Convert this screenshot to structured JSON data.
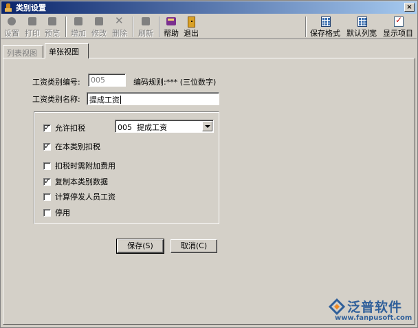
{
  "window": {
    "title": "类别设置",
    "close_label": "×"
  },
  "toolbar": {
    "left_buttons": [
      {
        "label": "设置",
        "icon": "settings-icon",
        "enabled": false
      },
      {
        "label": "打印",
        "icon": "print-icon",
        "enabled": false
      },
      {
        "label": "预览",
        "icon": "preview-icon",
        "enabled": false
      },
      {
        "label": "增加",
        "icon": "add-icon",
        "enabled": false
      },
      {
        "label": "修改",
        "icon": "edit-icon",
        "enabled": false
      },
      {
        "label": "删除",
        "icon": "delete-icon",
        "enabled": false
      },
      {
        "label": "刷新",
        "icon": "refresh-icon",
        "enabled": false
      },
      {
        "label": "帮助",
        "icon": "help-book-icon",
        "enabled": true
      },
      {
        "label": "退出",
        "icon": "exit-door-icon",
        "enabled": true
      }
    ],
    "right_buttons": [
      {
        "label": "保存格式",
        "icon": "save-format-icon"
      },
      {
        "label": "默认列宽",
        "icon": "default-width-icon"
      },
      {
        "label": "显示项目",
        "icon": "show-items-icon"
      }
    ]
  },
  "tabs": [
    {
      "label": "列表视图",
      "active": false
    },
    {
      "label": "单张视图",
      "active": true
    }
  ],
  "form": {
    "code_label": "工资类别编号:",
    "code_value": "005",
    "rule_text": "编码规则:*** (三位数字)",
    "name_label": "工资类别名称:",
    "name_value": "提成工资"
  },
  "options": {
    "allow_tax": {
      "label": "允许扣税",
      "checked": true
    },
    "tax_in_category": {
      "label": "在本类别扣税",
      "checked": true
    },
    "extra_fee": {
      "label": "扣税时需附加费用",
      "checked": false
    },
    "copy_data": {
      "label": "复制本类别数据",
      "checked": true
    },
    "suspended_pay": {
      "label": "计算停发人员工资",
      "checked": false
    },
    "disabled": {
      "label": "停用",
      "checked": false
    },
    "tax_category_select": "005  提成工资"
  },
  "actions": {
    "save_label": "保存(S)",
    "cancel_label": "取消(C)"
  },
  "brand": {
    "name": "泛普软件",
    "url": "www.fanpusoft.com",
    "color": "#2f5f9a"
  }
}
